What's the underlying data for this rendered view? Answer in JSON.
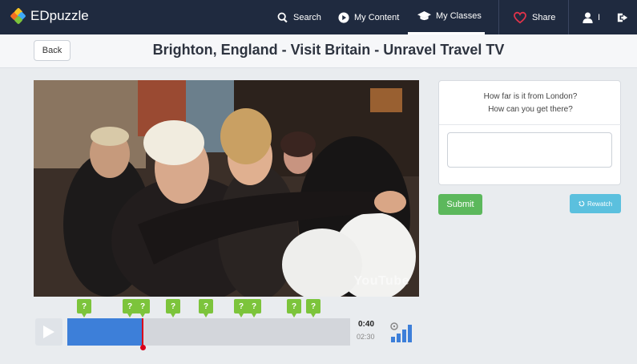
{
  "app": {
    "name": "EDpuzzle"
  },
  "nav": {
    "search": "Search",
    "my_content": "My Content",
    "my_classes": "My Classes",
    "share": "Share",
    "user_initial": "I"
  },
  "page": {
    "back_label": "Back",
    "title": "Brighton, England - Visit Britain - Unravel Travel TV"
  },
  "video": {
    "watermark": "YouTube"
  },
  "question": {
    "line1": "How far is it from London?",
    "line2": "How can you get there?",
    "answer_value": ""
  },
  "actions": {
    "submit_label": "Submit",
    "rewatch_label": "Rewatch"
  },
  "player": {
    "current_time": "0:40",
    "total_time": "02:30",
    "progress_fraction": 0.267,
    "question_marker_label": "?",
    "question_markers_fraction": [
      0.06,
      0.222,
      0.265,
      0.375,
      0.49,
      0.615,
      0.66,
      0.803,
      0.87
    ]
  },
  "colors": {
    "topbar": "#1f2a3f",
    "progress": "#3d7fd9",
    "playhead": "#d9001b",
    "marker": "#7cc43b",
    "submit": "#5cb85c",
    "rewatch": "#5bc0de"
  }
}
